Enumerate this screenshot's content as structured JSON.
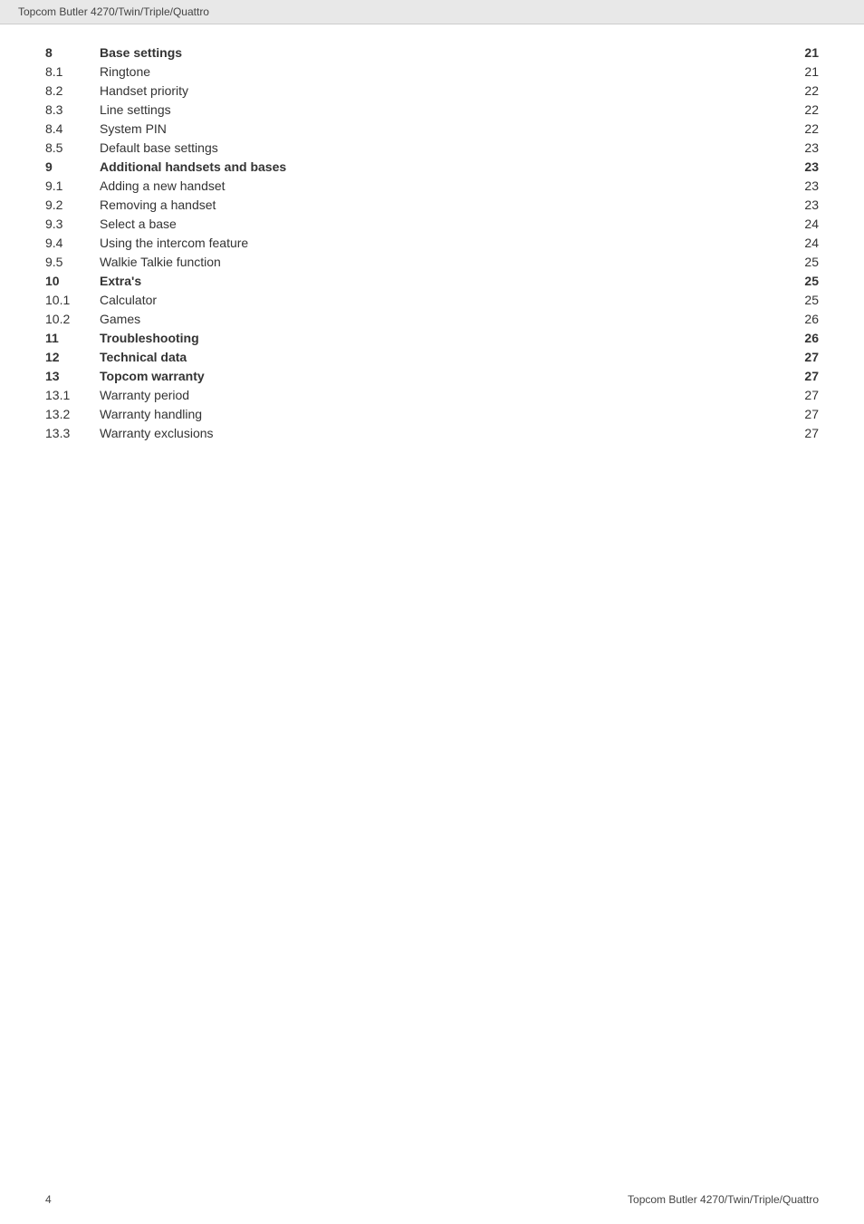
{
  "header": {
    "title": "Topcom Butler 4270/Twin/Triple/Quattro"
  },
  "footer": {
    "page_number": "4",
    "title": "Topcom Butler 4270/Twin/Triple/Quattro"
  },
  "toc": {
    "rows": [
      {
        "num": "8",
        "title": "Base settings",
        "page": "21",
        "bold": true
      },
      {
        "num": "8.1",
        "title": "Ringtone",
        "page": "21",
        "bold": false
      },
      {
        "num": "8.2",
        "title": "Handset priority",
        "page": "22",
        "bold": false
      },
      {
        "num": "8.3",
        "title": "Line settings",
        "page": "22",
        "bold": false
      },
      {
        "num": "8.4",
        "title": "System PIN",
        "page": "22",
        "bold": false
      },
      {
        "num": "8.5",
        "title": "Default base settings",
        "page": "23",
        "bold": false
      },
      {
        "num": "9",
        "title": "Additional handsets and bases",
        "page": "23",
        "bold": true
      },
      {
        "num": "9.1",
        "title": "Adding a new handset",
        "page": "23",
        "bold": false
      },
      {
        "num": "9.2",
        "title": "Removing a handset",
        "page": "23",
        "bold": false
      },
      {
        "num": "9.3",
        "title": "Select a base",
        "page": "24",
        "bold": false
      },
      {
        "num": "9.4",
        "title": "Using the intercom feature",
        "page": "24",
        "bold": false
      },
      {
        "num": "9.5",
        "title": "Walkie Talkie function",
        "page": "25",
        "bold": false
      },
      {
        "num": "10",
        "title": "Extra's",
        "page": "25",
        "bold": true
      },
      {
        "num": "10.1",
        "title": "Calculator",
        "page": "25",
        "bold": false
      },
      {
        "num": "10.2",
        "title": "Games",
        "page": "26",
        "bold": false
      },
      {
        "num": "11",
        "title": "Troubleshooting",
        "page": "26",
        "bold": true
      },
      {
        "num": "12",
        "title": "Technical data",
        "page": "27",
        "bold": true
      },
      {
        "num": "13",
        "title": "Topcom warranty",
        "page": "27",
        "bold": true
      },
      {
        "num": "13.1",
        "title": "Warranty period",
        "page": "27",
        "bold": false
      },
      {
        "num": "13.2",
        "title": "Warranty handling",
        "page": "27",
        "bold": false
      },
      {
        "num": "13.3",
        "title": "Warranty exclusions",
        "page": "27",
        "bold": false
      }
    ]
  }
}
